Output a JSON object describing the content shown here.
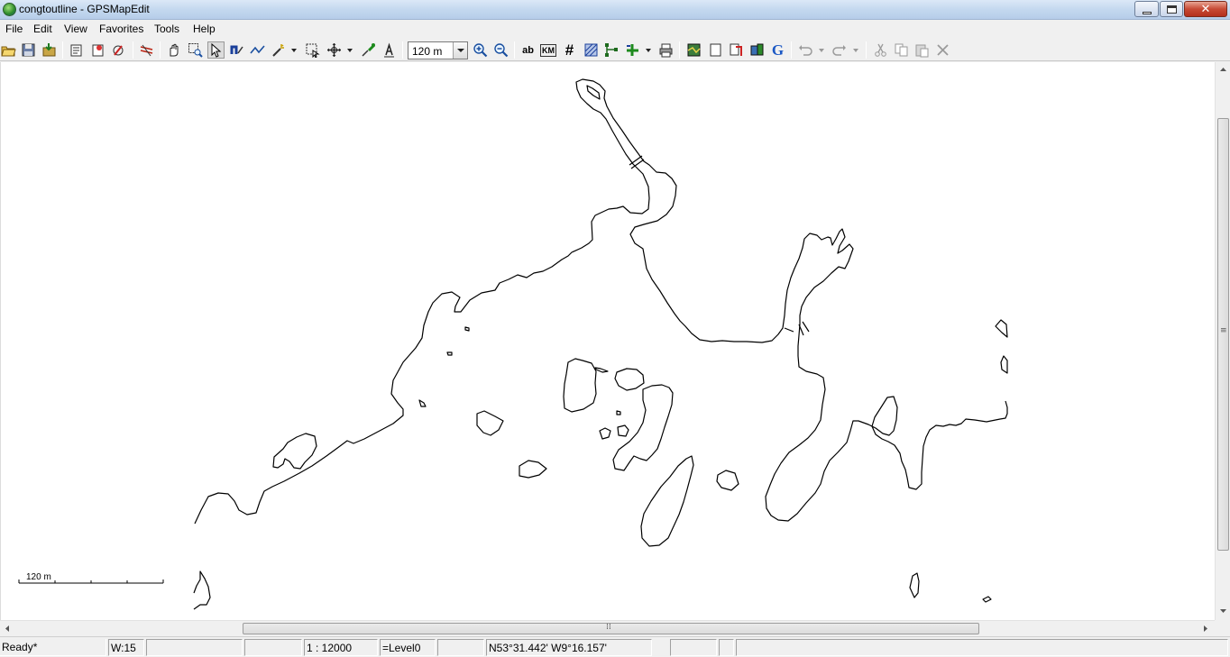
{
  "window": {
    "title": "congtoutline - GPSMapEdit",
    "app_icon": "globe-icon"
  },
  "menu": {
    "items": [
      "File",
      "Edit",
      "View",
      "Favorites",
      "Tools",
      "Help"
    ]
  },
  "toolbar": {
    "scale_combo_value": "120 m",
    "text_buttons": {
      "ab": "ab",
      "km": "KM",
      "grid": "#",
      "google": "G"
    }
  },
  "map": {
    "scale_bar_label": "120 m",
    "background_color": "#ffffff",
    "line_color": "#000000"
  },
  "status": {
    "state": "Ready*",
    "w": "W:15",
    "pane3": "",
    "pane4": "",
    "scale": "1 : 12000",
    "level": "=Level0",
    "pane7": "",
    "coords": "N53°31.442' W9°16.157'",
    "pane9": "",
    "pane10": "",
    "pane11": ""
  }
}
